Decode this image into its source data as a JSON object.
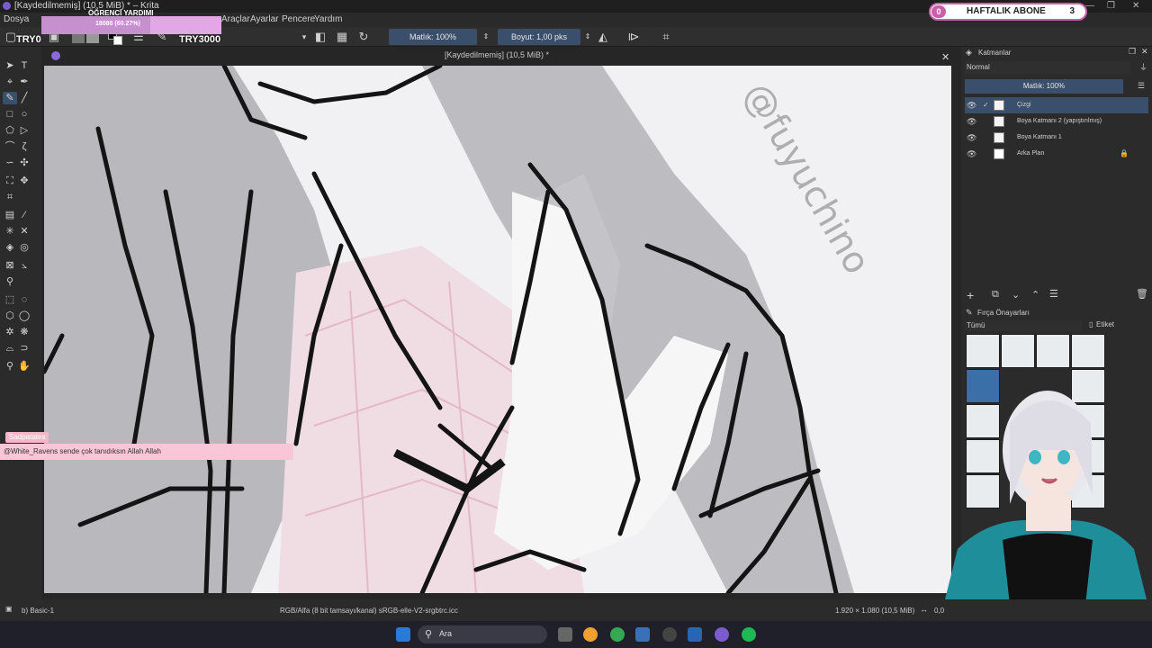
{
  "window": {
    "title": "[Kaydedilmemiş]  (10,5 MiB) * – Krita",
    "doc_title": "[Kaydedilmemiş]  (10,5 MiB) *"
  },
  "menu": {
    "items": [
      "Dosya",
      "Araçlar",
      "Ayarlar",
      "Pencere",
      "Yardım"
    ]
  },
  "toolbar": {
    "opacity_label": "Matlık: 100%",
    "size_label": "Boyut: 1,00 pks"
  },
  "overlays": {
    "subs_count_badge": "0",
    "subs_label": "HAFTALIK ABONE",
    "subs_value": "3",
    "goal_title": "ÖĞRENCİ YARDIMI",
    "goal_value": "18086 (60.27%)",
    "goal_fraction": 0.6027,
    "try_left": "TRY0",
    "try_right": "TRY3000",
    "chat_user": "Sadpatates",
    "chat_message": "@White_Ravens sende çok tanıdıksın Allah Allah"
  },
  "layers_panel": {
    "title": "Katmanlar",
    "blend": "Normal",
    "opacity": "Matlık:  100%",
    "layers": [
      {
        "name": "Çizgi",
        "selected": true
      },
      {
        "name": "Boya Katmanı 2 (yapıştırılmış)",
        "selected": false
      },
      {
        "name": "Boya Katmanı 1",
        "selected": false
      },
      {
        "name": "Arka Plan",
        "selected": false
      }
    ]
  },
  "brush_panel": {
    "title": "Fırça Önayarları",
    "filter": "Tümü",
    "tag_label": "Etiket"
  },
  "status": {
    "brush": "b) Basic-1",
    "color_info": "RGB/Alfa (8 bit tamsayı/kanal)  sRGB-elle-V2-srgbtrc.icc",
    "dimensions": "1.920 × 1.080 (10,5 MiB)",
    "zoom_partial": "0,0"
  },
  "taskbar": {
    "search_label": "Ara"
  },
  "canvas": {
    "watermark": "@fuyuchino"
  },
  "colors": {
    "accent": "#3a4f6b",
    "subs_border": "#c95fa9",
    "goal_bg": "#e3a6e7",
    "chat_bg": "#f8c6d6"
  }
}
